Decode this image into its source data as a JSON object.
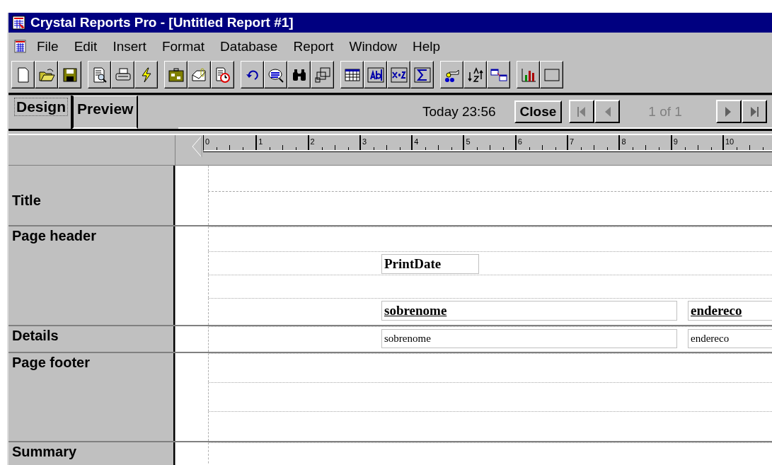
{
  "window": {
    "title": "Crystal Reports Pro - [Untitled Report #1]"
  },
  "menu": [
    {
      "label": "File"
    },
    {
      "label": "Edit"
    },
    {
      "label": "Insert"
    },
    {
      "label": "Format"
    },
    {
      "label": "Database"
    },
    {
      "label": "Report"
    },
    {
      "label": "Window"
    },
    {
      "label": "Help"
    }
  ],
  "tabs": [
    {
      "label": "Design",
      "selected": true
    },
    {
      "label": "Preview",
      "selected": false
    }
  ],
  "navigation": {
    "date": "Today 23:56",
    "close": "Close",
    "page": "1 of 1",
    "buttons": [
      {
        "kind": "first",
        "disabled": true
      },
      {
        "kind": "previous",
        "disabled": true
      },
      {
        "kind": "next",
        "disabled": false
      },
      {
        "kind": "last",
        "disabled": false
      }
    ]
  },
  "ruler": [
    "0",
    "1",
    "2",
    "3",
    "4",
    "5",
    "6",
    "7",
    "8",
    "9",
    "10"
  ],
  "sections": [
    {
      "name": "Title",
      "kind": "title"
    },
    {
      "name": "Page header",
      "kind": "page_header",
      "rows": [
        [
          {
            "text": "PrintDate",
            "kind": "heading",
            "underlined": false
          }
        ],
        [
          {
            "text": "sobrenome",
            "kind": "heading",
            "underlined": true
          },
          {
            "text": "endereco",
            "kind": "heading",
            "underlined": true
          }
        ]
      ]
    },
    {
      "name": "Details",
      "kind": "details",
      "rows": [
        [
          {
            "text": "sobrenome",
            "kind": "value",
            "underlined": false
          },
          {
            "text": "endereco",
            "kind": "value",
            "underlined": false
          }
        ]
      ]
    },
    {
      "name": "Page footer",
      "kind": "page_footer"
    },
    {
      "name": "Summary",
      "kind": "summary"
    }
  ]
}
